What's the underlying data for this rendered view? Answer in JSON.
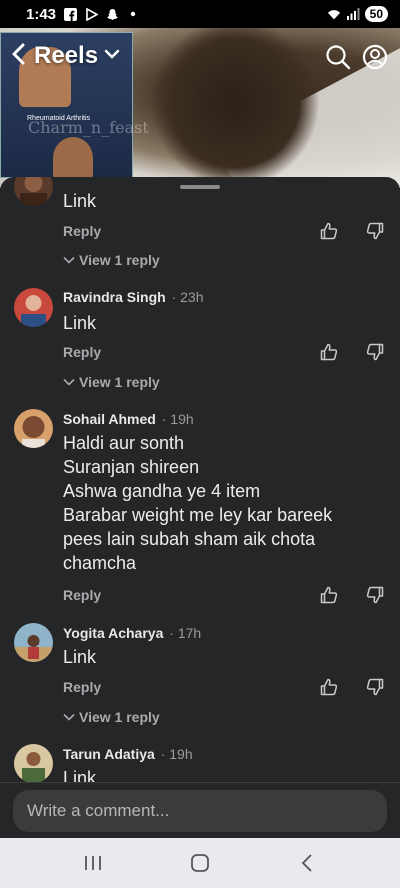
{
  "status_bar": {
    "time": "1:43",
    "battery": "50",
    "icons": [
      "facebook-icon",
      "play-icon",
      "snapchat-icon",
      "dot-icon",
      "wifi-icon",
      "signal-icon"
    ]
  },
  "header": {
    "title": "Reels",
    "thumbnail_caption": "Rheumatoid Arthritis",
    "watermark": "Charm_n_feast"
  },
  "comments": [
    {
      "name": "",
      "time": "",
      "text": "Link",
      "reply_label": "Reply",
      "view_replies": "View 1 reply"
    },
    {
      "name": "Ravindra Singh",
      "time": "23h",
      "text": "Link",
      "reply_label": "Reply",
      "view_replies": "View 1 reply"
    },
    {
      "name": "Sohail Ahmed",
      "time": "19h",
      "text_lines": [
        "Haldi aur sonth",
        "Suranjan shireen",
        "Ashwa gandha ye 4 item",
        "Barabar weight me ley kar bareek",
        "pees lain subah sham aik chota",
        "chamcha"
      ],
      "reply_label": "Reply"
    },
    {
      "name": "Yogita Acharya",
      "time": "17h",
      "text": "Link",
      "reply_label": "Reply",
      "view_replies": "View 1 reply"
    },
    {
      "name": "Tarun Adatiya",
      "time": "19h",
      "text": "Link"
    }
  ],
  "composer": {
    "placeholder": "Write a comment..."
  },
  "colors": {
    "sheet_bg": "#252628",
    "text_primary": "#ececec",
    "text_secondary": "#a9aaac",
    "input_bg": "#3a3b3d"
  }
}
